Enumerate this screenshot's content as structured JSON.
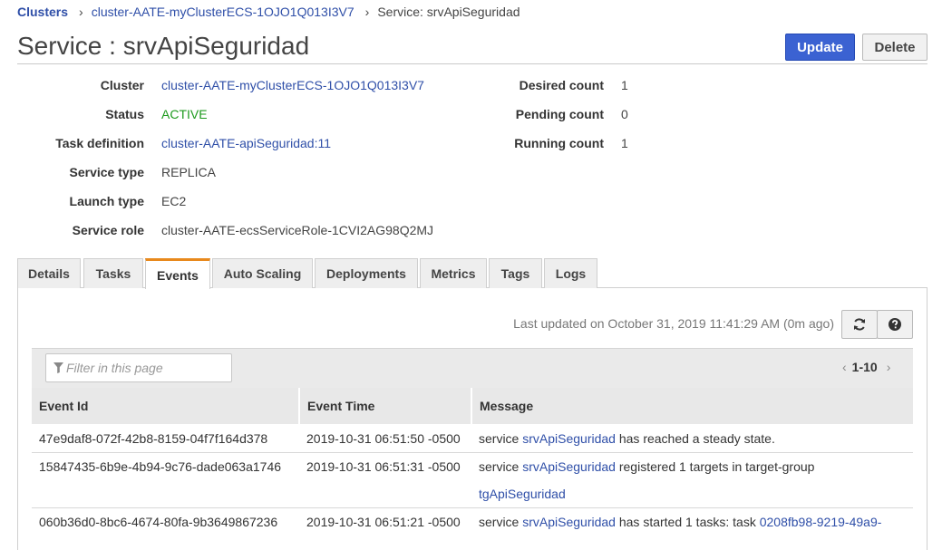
{
  "breadcrumb": {
    "home": "Clusters",
    "cluster": "cluster-AATE-myClusterECS-1OJO1Q013I3V7",
    "current": "Service: srvApiSeguridad",
    "separator": "›"
  },
  "page_title": "Service : srvApiSeguridad",
  "buttons": {
    "update": "Update",
    "delete": "Delete"
  },
  "details_left": [
    {
      "label": "Cluster",
      "value": "cluster-AATE-myClusterECS-1OJO1Q013I3V7"
    },
    {
      "label": "Status",
      "value": "ACTIVE"
    },
    {
      "label": "Task definition",
      "value": "cluster-AATE-apiSeguridad:11"
    },
    {
      "label": "Service type",
      "value": "REPLICA"
    },
    {
      "label": "Launch type",
      "value": "EC2"
    },
    {
      "label": "Service role",
      "value": "cluster-AATE-ecsServiceRole-1CVI2AG98Q2MJ"
    }
  ],
  "details_right": [
    {
      "label": "Desired count",
      "value": "1"
    },
    {
      "label": "Pending count",
      "value": "0"
    },
    {
      "label": "Running count",
      "value": "1"
    }
  ],
  "tabs": [
    "Details",
    "Tasks",
    "Events",
    "Auto Scaling",
    "Deployments",
    "Metrics",
    "Tags",
    "Logs"
  ],
  "active_tab": "Events",
  "events": {
    "last_updated": "Last updated on October 31, 2019 11:41:29 AM (0m ago)",
    "filter_placeholder": "Filter in this page",
    "pager": "1-10",
    "columns": [
      "Event Id",
      "Event Time",
      "Message"
    ],
    "rows": [
      {
        "id": "47e9daf8-072f-42b8-8159-04f7f164d378",
        "time": "2019-10-31 06:51:50 -0500",
        "msg_prefix": "service ",
        "msg_link": "srvApiSeguridad",
        "msg_suffix": " has reached a steady state.",
        "msg_line2_link": "",
        "msg_line1_link2": ""
      },
      {
        "id": "15847435-6b9e-4b94-9c76-dade063a1746",
        "time": "2019-10-31 06:51:31 -0500",
        "msg_prefix": "service ",
        "msg_link": "srvApiSeguridad",
        "msg_suffix": " registered 1 targets in target-group",
        "msg_line2_link": "tgApiSeguridad",
        "msg_line1_link2": ""
      },
      {
        "id": "060b36d0-8bc6-4674-80fa-9b3649867236",
        "time": "2019-10-31 06:51:21 -0500",
        "msg_prefix": "service ",
        "msg_link": "srvApiSeguridad",
        "msg_suffix": " has started 1 tasks: task ",
        "msg_line2_link": "",
        "msg_line1_link2": "0208fb98-9219-49a9-"
      }
    ]
  },
  "colors": {
    "link": "#2f4fa8",
    "status_active": "#1d9a1d",
    "primary_button": "#3b62d2",
    "active_tab_accent": "#e8891d"
  }
}
